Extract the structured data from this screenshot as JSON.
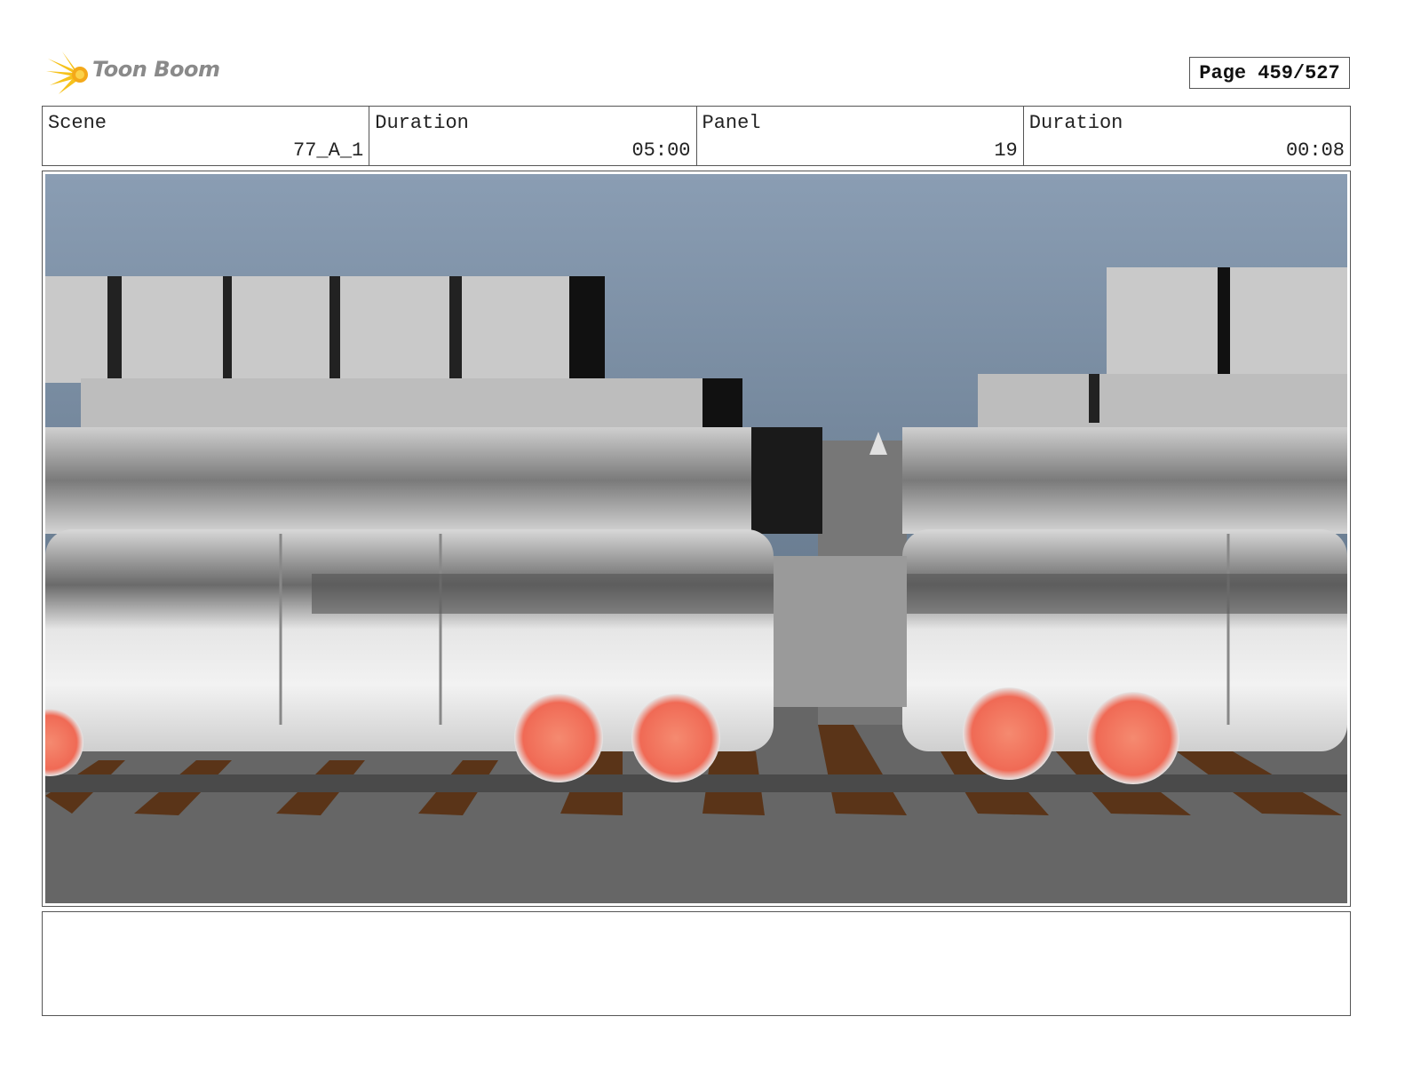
{
  "header": {
    "logo_text": "Toon Boom",
    "page_label": "Page 459/527"
  },
  "info": {
    "scene_label": "Scene",
    "scene_value": "77_A_1",
    "duration_label": "Duration",
    "duration_value": "05:00",
    "panel_label": "Panel",
    "panel_value": "19",
    "panel_duration_label": "Duration",
    "panel_duration_value": "00:08"
  },
  "panel_image": {
    "description_icon": "train-render-image",
    "sky_color": "#8a9db3",
    "ground_color": "#6a6a6a",
    "wheel_color": "#f0806a"
  },
  "notes": {
    "text": ""
  }
}
